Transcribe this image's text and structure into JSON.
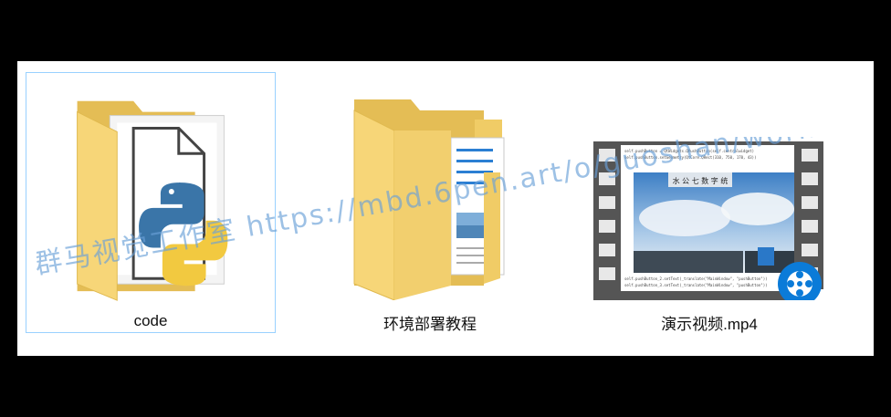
{
  "files": [
    {
      "name": "code",
      "icon": "python-folder-icon",
      "selected": true
    },
    {
      "name": "环境部署教程",
      "icon": "document-folder-icon",
      "selected": false
    },
    {
      "name": "演示视频.mp4",
      "icon": "video-thumbnail-icon",
      "selected": false
    }
  ],
  "video_preview": {
    "window_title": "水 公 七 数 字 统",
    "code_lines": [
      "self.pushButton = QtWidgets.QPushButton(self.centralwidget)",
      "self.pushButton.setGeometry(QtCore.QRect(310, 750, 170, 43))",
      "self.pushButton_2.setText(_translate(\"MainWindow\", \"pushButton\"))",
      "self.pushButton_3.setText(_translate(\"MainWindow\", \"pushButton\"))"
    ]
  },
  "watermark": "群马视觉工作室 https://mbd.6pen.art/o/guoshan/work",
  "colors": {
    "folder_back": "#e8c35c",
    "folder_front": "#f8d777",
    "selection_border": "#99d1ff",
    "player_blue": "#0b7bd8"
  }
}
